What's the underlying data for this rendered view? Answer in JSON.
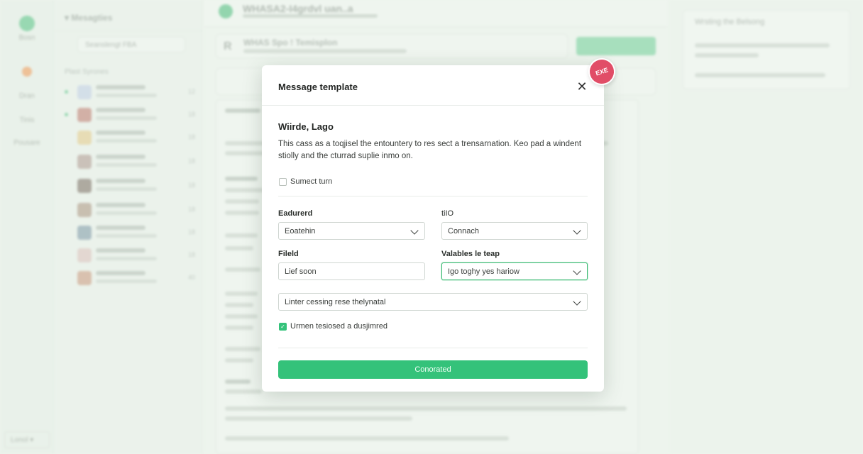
{
  "background": {
    "rail": {
      "items": [
        "Bosn",
        "Dran",
        "Tinis",
        "Pousare"
      ],
      "footer": "Lonol"
    },
    "messages": {
      "title": "Mesagties",
      "filter": "Seanslengt FBA",
      "section": "Plast Syrones",
      "counts": [
        "12",
        "18",
        "18",
        "18",
        "18",
        "18",
        "18",
        "18",
        "18",
        "40"
      ]
    },
    "main": {
      "title": "WHASA2-I4grdvl uan..a",
      "template_header": "WHAS Spo ! Temisplon"
    },
    "side": {
      "title": "Wrsting the Belsong"
    }
  },
  "modal": {
    "title": "Message template",
    "badge": "EXE",
    "section_title": "Wiirde, Lago",
    "description": "This cass as a toqjisel the entountery to res sect a trensarnation. Keo pad a windent stiolly and the cturrad suplie inmo on.",
    "checkbox1": {
      "label": "Sumect turn",
      "checked": false
    },
    "fields": {
      "endpoint": {
        "label": "Eadurerd",
        "value": "Eoatehin"
      },
      "to": {
        "label": "tiIO",
        "value": "Connach"
      },
      "field": {
        "label": "Fileld",
        "value": "Lief soon"
      },
      "variables": {
        "label": "Valables le teap",
        "value": "Igo toghy yes hariow"
      },
      "message": {
        "value": "Linter cessing rese thelynatal"
      }
    },
    "checkbox2": {
      "label": "Urmen tesiosed a dusjimred",
      "checked": true
    },
    "submit": "Conorated"
  }
}
